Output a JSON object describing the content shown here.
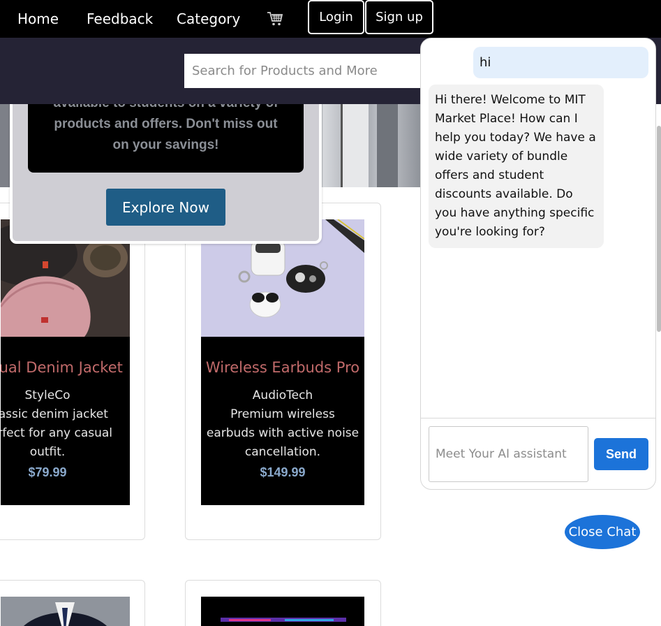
{
  "nav": {
    "home": "Home",
    "feedback": "Feedback",
    "category": "Category",
    "cart_icon": "shopping-cart-icon",
    "login": "Login",
    "signup": "Sign up"
  },
  "search": {
    "placeholder": "Search for Products and More"
  },
  "promo": {
    "text": "available to students on a variety of products and offers. Don't miss out on your savings!",
    "button": "Explore Now"
  },
  "products": [
    {
      "title": "Casual Denim Jacket",
      "brand": "StyleCo",
      "description": "Classic denim jacket perfect for any casual outfit.",
      "price": "$79.99"
    },
    {
      "title": "Wireless Earbuds Pro",
      "brand": "AudioTech",
      "description": "Premium wireless earbuds with active noise cancellation.",
      "price": "$149.99"
    }
  ],
  "chat": {
    "messages": [
      {
        "role": "user",
        "text": "hi"
      },
      {
        "role": "assistant",
        "text": "Hi there! Welcome to MIT Market Place! How can I help you today? We have a wide variety of bundle offers and student discounts available. Do you have anything specific you're looking for?"
      }
    ],
    "input_placeholder": "Meet Your AI assistant",
    "send": "Send",
    "close": "Close Chat"
  },
  "colors": {
    "navbar": "#000000",
    "search_band": "#252335",
    "accent": "#1c73d9",
    "product_title": "#c16a6a",
    "price": "#8aa9cc"
  }
}
